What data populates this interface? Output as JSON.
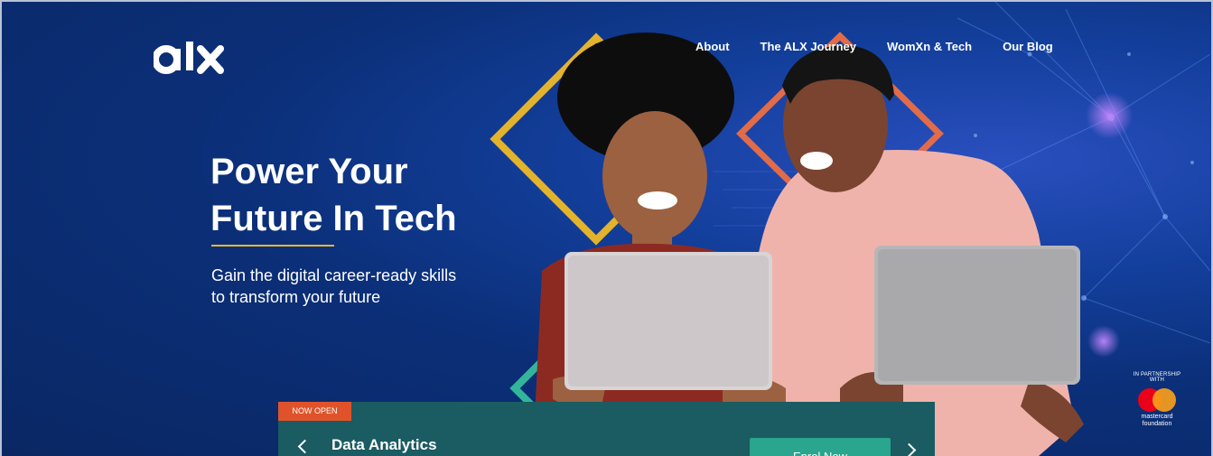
{
  "nav": {
    "links": [
      "About",
      "The ALX Journey",
      "WomXn & Tech",
      "Our Blog"
    ]
  },
  "hero": {
    "title_line1": "Power Your",
    "title_line2": "Future In Tech",
    "subtitle_line1": "Gain the digital career-ready skills",
    "subtitle_line2": "to transform your future"
  },
  "partner": {
    "label": "IN PARTNERSHIP WITH",
    "brand_line1": "mastercard",
    "brand_line2": "foundation"
  },
  "course_card": {
    "badge": "NOW OPEN",
    "title": "Data Analytics",
    "cta": "Enrol Now"
  },
  "colors": {
    "brand_accent": "#f2b928",
    "card_background": "#1b5b62",
    "cta_background": "#2aa58e",
    "badge_background": "#e0532a"
  },
  "icons": [
    "alx-logo",
    "chevron-left-icon",
    "chevron-right-icon",
    "mastercard-logo"
  ]
}
